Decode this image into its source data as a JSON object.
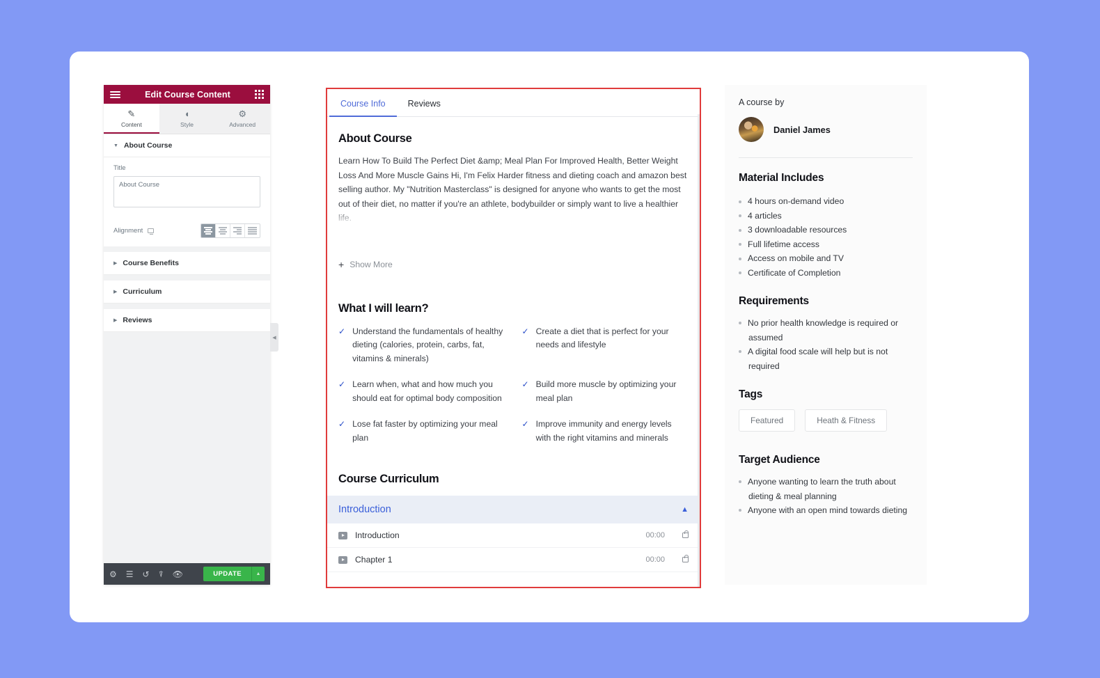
{
  "theme": {
    "page_background": "#8299f5",
    "panel_header_bg": "#9b0e3e",
    "update_button_bg": "#39b54a",
    "accent_blue": "#3a5fd9",
    "selection_border": "#e03b3b"
  },
  "panel": {
    "header": {
      "title": "Edit Course Content",
      "menu_icon": "hamburger-icon",
      "grid_icon": "grid-icon"
    },
    "tabs": [
      {
        "label": "Content",
        "icon": "pencil-icon",
        "active": true
      },
      {
        "label": "Style",
        "icon": "contrast-icon",
        "active": false
      },
      {
        "label": "Advanced",
        "icon": "gear-icon",
        "active": false
      }
    ],
    "sections": [
      {
        "label": "About Course",
        "expanded": true
      },
      {
        "label": "Course Benefits",
        "expanded": false
      },
      {
        "label": "Curriculum",
        "expanded": false
      },
      {
        "label": "Reviews",
        "expanded": false
      }
    ],
    "title_field": {
      "label": "Title",
      "value": "About Course",
      "placeholder": "About Course"
    },
    "alignment": {
      "label": "Alignment",
      "device_icon": "desktop-icon",
      "options": [
        "align-left",
        "align-center",
        "align-right",
        "align-justify"
      ],
      "selected": "align-left"
    },
    "footer": {
      "icons": [
        "gear-icon",
        "layers-icon",
        "history-icon",
        "responsive-icon",
        "eye-icon"
      ],
      "update_label": "UPDATE",
      "caret": "caret-up-icon"
    },
    "collapse_handle": "chevron-left-icon"
  },
  "preview": {
    "tabs": [
      {
        "label": "Course Info",
        "active": true
      },
      {
        "label": "Reviews",
        "active": false
      }
    ],
    "about": {
      "heading": "About Course",
      "body": "Learn How To Build The Perfect Diet &amp; Meal Plan For Improved Health, Better Weight Loss And More Muscle Gains Hi, I'm Felix Harder fitness and dieting coach and amazon best selling author. My \"Nutrition Masterclass\" is designed for anyone who wants to get the most out of their diet, no matter if you're an athlete, bodybuilder or simply want to live a healthier life.",
      "show_more_label": "Show More",
      "show_more_icon": "plus-icon"
    },
    "learn": {
      "heading": "What I will learn?",
      "items": [
        "Understand the fundamentals of healthy dieting (calories, protein, carbs, fat, vitamins & minerals)",
        "Create a diet that is perfect for your needs and lifestyle",
        "Learn when, what and how much you should eat for optimal body composition",
        "Build more muscle by optimizing your meal plan",
        "Lose fat faster by optimizing your meal plan",
        "Improve immunity and energy levels with the right vitamins and minerals"
      ]
    },
    "curriculum": {
      "heading": "Course Curriculum",
      "section_title": "Introduction",
      "toggle_icon": "chevron-up-icon",
      "lessons": [
        {
          "title": "Introduction",
          "duration": "00:00",
          "icon": "play-icon",
          "lock": "lock-icon"
        },
        {
          "title": "Chapter 1",
          "duration": "00:00",
          "icon": "play-icon",
          "lock": "lock-icon"
        }
      ]
    }
  },
  "rail": {
    "course_by_label": "A course by",
    "author": "Daniel James",
    "material": {
      "heading": "Material Includes",
      "items": [
        "4 hours on-demand video",
        "4 articles",
        "3 downloadable resources",
        "Full lifetime access",
        "Access on mobile and TV",
        "Certificate of Completion"
      ]
    },
    "requirements": {
      "heading": "Requirements",
      "items": [
        "No prior health knowledge is required or assumed",
        "A digital food scale will help but is not required"
      ]
    },
    "tags": {
      "heading": "Tags",
      "items": [
        "Featured",
        "Heath & Fitness"
      ]
    },
    "audience": {
      "heading": "Target Audience",
      "items": [
        "Anyone wanting to learn the truth about dieting & meal planning",
        "Anyone with an open mind towards dieting"
      ]
    }
  }
}
